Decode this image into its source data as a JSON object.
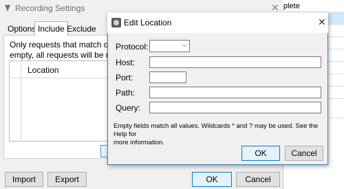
{
  "background_app": {
    "cells": [
      "plete",
      "",
      "",
      "",
      "",
      "",
      "",
      "",
      "",
      "□□□□"
    ]
  },
  "recording_settings": {
    "title": "Recording Settings",
    "close_glyph": "✕",
    "tabs": [
      {
        "label": "Options",
        "active": false
      },
      {
        "label": "Include",
        "active": true
      },
      {
        "label": "Exclude",
        "active": false
      }
    ],
    "description_line1": "Only requests that match one o",
    "description_line2": "empty, all requests will be reco",
    "table": {
      "columns": [
        "Location"
      ]
    },
    "buttons": {
      "import": "Import",
      "export": "Export",
      "ok": "OK",
      "cancel": "Cancel"
    }
  },
  "edit_location": {
    "title": "Edit Location",
    "close_glyph": "✕",
    "fields": {
      "protocol_label": "Protocol:",
      "protocol_value": "",
      "host_label": "Host:",
      "host_value": "",
      "port_label": "Port:",
      "port_value": "",
      "path_label": "Path:",
      "path_value": "",
      "query_label": "Query:",
      "query_value": ""
    },
    "note_line1": "Empty fields match all values. Wildcards * and ? may be used. See the Help for",
    "note_line2": "more information.",
    "buttons": {
      "ok": "OK",
      "cancel": "Cancel"
    }
  }
}
